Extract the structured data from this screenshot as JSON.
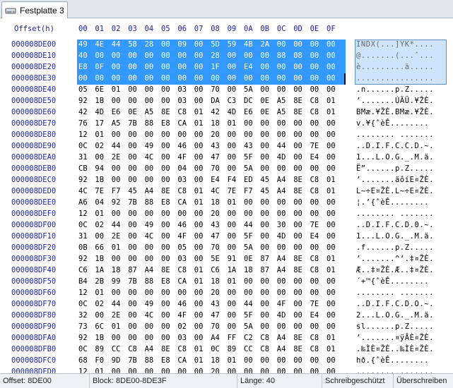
{
  "tab": {
    "label": "Festplatte 3",
    "icon": "disk-drive-icon"
  },
  "header": {
    "offset_label": "Offset(h)",
    "columns": [
      "00",
      "01",
      "02",
      "03",
      "04",
      "05",
      "06",
      "07",
      "08",
      "09",
      "0A",
      "0B",
      "0C",
      "0D",
      "0E",
      "0F"
    ]
  },
  "rows": [
    {
      "offset": "000008DE00",
      "hex": [
        "49",
        "4E",
        "44",
        "58",
        "28",
        "00",
        "09",
        "00",
        "5D",
        "59",
        "4B",
        "2A",
        "00",
        "00",
        "00",
        "00"
      ],
      "text": "INDX(...]YK*....",
      "selected": true
    },
    {
      "offset": "000008DE10",
      "hex": [
        "40",
        "00",
        "00",
        "00",
        "00",
        "00",
        "00",
        "00",
        "28",
        "00",
        "00",
        "00",
        "88",
        "08",
        "00",
        "00"
      ],
      "text": "@.......(...ˆ...",
      "selected": true
    },
    {
      "offset": "000008DE20",
      "hex": [
        "E8",
        "0F",
        "00",
        "00",
        "00",
        "00",
        "00",
        "00",
        "1F",
        "00",
        "E4",
        "00",
        "00",
        "00",
        "00",
        "00"
      ],
      "text": "è.........ä.....",
      "selected": true
    },
    {
      "offset": "000008DE30",
      "hex": [
        "00",
        "00",
        "00",
        "00",
        "00",
        "00",
        "00",
        "00",
        "00",
        "00",
        "00",
        "00",
        "00",
        "00",
        "00",
        "00"
      ],
      "text": "................",
      "selected": true
    },
    {
      "offset": "000008DE40",
      "hex": [
        "05",
        "6E",
        "01",
        "00",
        "00",
        "00",
        "03",
        "00",
        "70",
        "00",
        "5A",
        "00",
        "00",
        "00",
        "00",
        "00"
      ],
      "text": ".n......p.Z.....",
      "selected": false
    },
    {
      "offset": "000008DE50",
      "hex": [
        "92",
        "1B",
        "00",
        "00",
        "00",
        "00",
        "03",
        "00",
        "DA",
        "C3",
        "DC",
        "0E",
        "A5",
        "8E",
        "C8",
        "01"
      ],
      "text": "’.......ÚÃÜ.¥ŽÈ.",
      "selected": false
    },
    {
      "offset": "000008DE60",
      "hex": [
        "42",
        "4D",
        "E6",
        "0E",
        "A5",
        "8E",
        "C8",
        "01",
        "42",
        "4D",
        "E6",
        "0E",
        "A5",
        "8E",
        "C8",
        "01"
      ],
      "text": "BMæ.¥ŽÈ.BMæ.¥ŽÈ.",
      "selected": false
    },
    {
      "offset": "000008DE70",
      "hex": [
        "76",
        "17",
        "A5",
        "7B",
        "88",
        "E8",
        "CA",
        "01",
        "18",
        "01",
        "00",
        "00",
        "00",
        "00",
        "00",
        "00"
      ],
      "text": "v.¥{ˆèÊ........",
      "selected": false
    },
    {
      "offset": "000008DE80",
      "hex": [
        "12",
        "01",
        "00",
        "00",
        "00",
        "00",
        "00",
        "00",
        "20",
        "00",
        "00",
        "00",
        "00",
        "00",
        "00",
        "00"
      ],
      "text": "........ .......",
      "selected": false
    },
    {
      "offset": "000008DE90",
      "hex": [
        "0C",
        "02",
        "44",
        "00",
        "49",
        "00",
        "46",
        "00",
        "43",
        "00",
        "43",
        "00",
        "44",
        "00",
        "7E",
        "00"
      ],
      "text": "..D.I.F.C.C.D.~.",
      "selected": false
    },
    {
      "offset": "000008DEA0",
      "hex": [
        "31",
        "00",
        "2E",
        "00",
        "4C",
        "00",
        "4F",
        "00",
        "47",
        "00",
        "5F",
        "00",
        "4D",
        "00",
        "E4",
        "00"
      ],
      "text": "1...L.O.G._.M.ä.",
      "selected": false
    },
    {
      "offset": "000008DEB0",
      "hex": [
        "CB",
        "94",
        "00",
        "00",
        "00",
        "00",
        "04",
        "00",
        "70",
        "00",
        "5A",
        "00",
        "00",
        "00",
        "00",
        "00"
      ],
      "text": "Ë”......p.Z.....",
      "selected": false
    },
    {
      "offset": "000008DEC0",
      "hex": [
        "92",
        "1B",
        "00",
        "00",
        "00",
        "00",
        "03",
        "00",
        "E4",
        "F4",
        "ED",
        "45",
        "A4",
        "8E",
        "C8",
        "01"
      ],
      "text": "’.......äôíE¤ŽÈ.",
      "selected": false
    },
    {
      "offset": "000008DED0",
      "hex": [
        "4C",
        "7E",
        "F7",
        "45",
        "A4",
        "8E",
        "C8",
        "01",
        "4C",
        "7E",
        "F7",
        "45",
        "A4",
        "8E",
        "C8",
        "01"
      ],
      "text": "L~÷E¤ŽÈ.L~÷E¤ŽÈ.",
      "selected": false
    },
    {
      "offset": "000008DEE0",
      "hex": [
        "A6",
        "04",
        "92",
        "7B",
        "88",
        "E8",
        "CA",
        "01",
        "18",
        "01",
        "00",
        "00",
        "00",
        "00",
        "00",
        "00"
      ],
      "text": "¦.’{ˆèÊ........",
      "selected": false
    },
    {
      "offset": "000008DEF0",
      "hex": [
        "12",
        "01",
        "00",
        "00",
        "00",
        "00",
        "00",
        "00",
        "20",
        "00",
        "00",
        "00",
        "00",
        "00",
        "00",
        "00"
      ],
      "text": "........ .......",
      "selected": false
    },
    {
      "offset": "000008DF00",
      "hex": [
        "0C",
        "02",
        "44",
        "00",
        "49",
        "00",
        "46",
        "00",
        "43",
        "00",
        "44",
        "00",
        "30",
        "00",
        "7E",
        "00"
      ],
      "text": "..D.I.F.C.D.0.~.",
      "selected": false
    },
    {
      "offset": "000008DF10",
      "hex": [
        "31",
        "00",
        "2E",
        "00",
        "4C",
        "00",
        "4F",
        "00",
        "47",
        "00",
        "5F",
        "00",
        "4D",
        "00",
        "E4",
        "00"
      ],
      "text": "1...L.O.G._.M.ä.",
      "selected": false
    },
    {
      "offset": "000008DF20",
      "hex": [
        "0B",
        "66",
        "01",
        "00",
        "00",
        "00",
        "05",
        "00",
        "70",
        "00",
        "5A",
        "00",
        "00",
        "00",
        "00",
        "00"
      ],
      "text": ".f......p.Z.....",
      "selected": false
    },
    {
      "offset": "000008DF30",
      "hex": [
        "92",
        "1B",
        "00",
        "00",
        "00",
        "00",
        "03",
        "00",
        "5E",
        "91",
        "0E",
        "87",
        "A4",
        "8E",
        "C8",
        "01"
      ],
      "text": "’.......^‘.‡¤ŽÈ.",
      "selected": false
    },
    {
      "offset": "000008DF40",
      "hex": [
        "C6",
        "1A",
        "18",
        "87",
        "A4",
        "8E",
        "C8",
        "01",
        "C6",
        "1A",
        "18",
        "87",
        "A4",
        "8E",
        "C8",
        "01"
      ],
      "text": "Æ..‡¤ŽÈ.Æ..‡¤ŽÈ.",
      "selected": false
    },
    {
      "offset": "000008DF50",
      "hex": [
        "B4",
        "2B",
        "99",
        "7B",
        "88",
        "E8",
        "CA",
        "01",
        "18",
        "01",
        "00",
        "00",
        "00",
        "00",
        "00",
        "00"
      ],
      "text": "´+™{ˆèÊ........",
      "selected": false
    },
    {
      "offset": "000008DF60",
      "hex": [
        "12",
        "01",
        "00",
        "00",
        "00",
        "00",
        "00",
        "00",
        "20",
        "00",
        "00",
        "00",
        "00",
        "00",
        "00",
        "00"
      ],
      "text": "........ .......",
      "selected": false
    },
    {
      "offset": "000008DF70",
      "hex": [
        "0C",
        "02",
        "44",
        "00",
        "49",
        "00",
        "46",
        "00",
        "43",
        "00",
        "44",
        "00",
        "4F",
        "00",
        "7E",
        "00"
      ],
      "text": "..D.I.F.C.D.O.~.",
      "selected": false
    },
    {
      "offset": "000008DF80",
      "hex": [
        "32",
        "00",
        "2E",
        "00",
        "4C",
        "00",
        "4F",
        "00",
        "47",
        "00",
        "5F",
        "00",
        "4D",
        "00",
        "E4",
        "00"
      ],
      "text": "2...L.O.G._.M.ä.",
      "selected": false
    },
    {
      "offset": "000008DF90",
      "hex": [
        "73",
        "6C",
        "01",
        "00",
        "00",
        "00",
        "02",
        "00",
        "70",
        "00",
        "5A",
        "00",
        "00",
        "00",
        "00",
        "00"
      ],
      "text": "sl......p.Z.....",
      "selected": false
    },
    {
      "offset": "000008DFA0",
      "hex": [
        "92",
        "1B",
        "00",
        "00",
        "00",
        "00",
        "03",
        "00",
        "A4",
        "FF",
        "C2",
        "C8",
        "A4",
        "8E",
        "C8",
        "01"
      ],
      "text": "’.......¤ÿÂÈ¤ŽÈ.",
      "selected": false
    },
    {
      "offset": "000008DFB0",
      "hex": [
        "0C",
        "89",
        "CC",
        "C8",
        "A4",
        "8E",
        "C8",
        "01",
        "0C",
        "89",
        "CC",
        "C8",
        "A4",
        "8E",
        "C8",
        "01"
      ],
      "text": ".‰ÌÈ¤ŽÈ..‰ÌÈ¤ŽÈ.",
      "selected": false
    },
    {
      "offset": "000008DFC0",
      "hex": [
        "68",
        "F0",
        "9D",
        "7B",
        "88",
        "E8",
        "CA",
        "01",
        "18",
        "01",
        "00",
        "00",
        "00",
        "00",
        "00",
        "00"
      ],
      "text": "hð.{ˆèÊ........",
      "selected": false
    },
    {
      "offset": "000008DFD0",
      "hex": [
        "12",
        "01",
        "00",
        "00",
        "00",
        "00",
        "00",
        "00",
        "20",
        "00",
        "00",
        "00",
        "00",
        "00",
        "00",
        "00"
      ],
      "text": "........ .......",
      "selected": false
    }
  ],
  "statusbar": {
    "offset": "Offset: 8DE00",
    "block": "Block: 8DE00-8DE3F",
    "length": "Länge: 40",
    "mode": "Schreibgeschützt",
    "overwrite": "Überschreiben"
  }
}
